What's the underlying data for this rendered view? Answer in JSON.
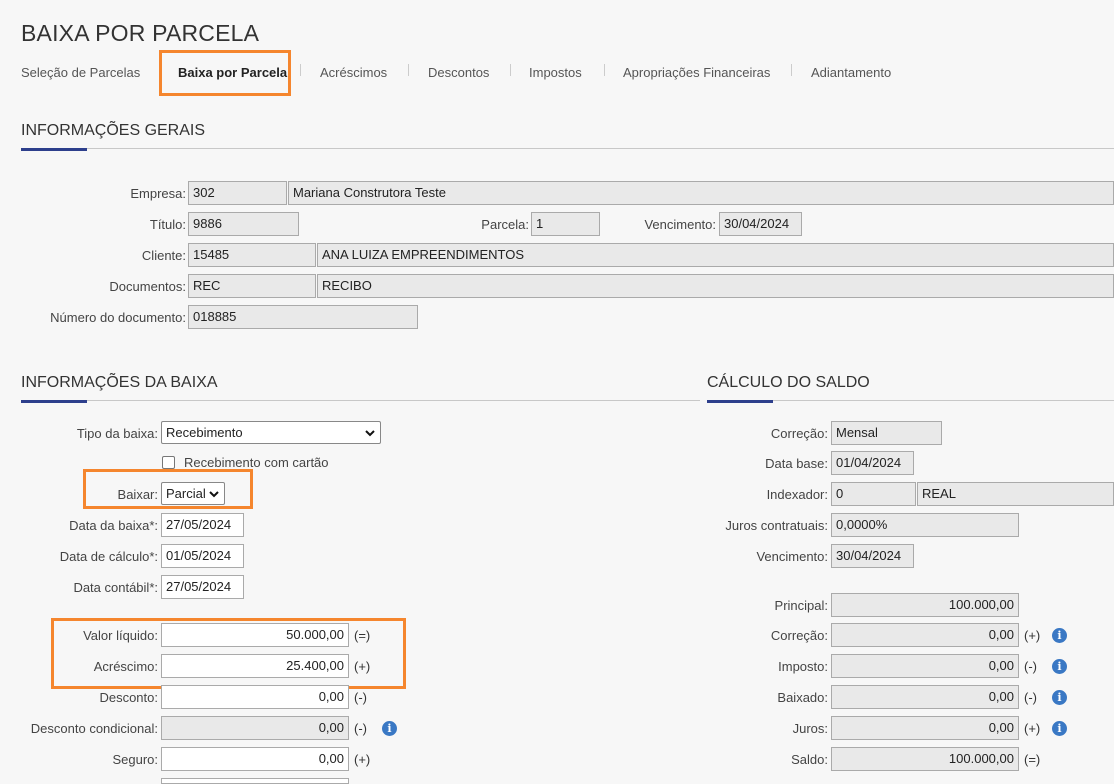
{
  "page_title": "BAIXA POR PARCELA",
  "tabs": [
    {
      "label": "Seleção de Parcelas"
    },
    {
      "label": "Baixa por Parcela"
    },
    {
      "label": "Acréscimos"
    },
    {
      "label": "Descontos"
    },
    {
      "label": "Impostos"
    },
    {
      "label": "Apropriações Financeiras"
    },
    {
      "label": "Adiantamento"
    }
  ],
  "active_tab": "Baixa por Parcela",
  "info_gerais": {
    "title": "INFORMAÇÕES GERAIS",
    "empresa_label": "Empresa:",
    "empresa_code": "302",
    "empresa_name": "Mariana Construtora Teste",
    "titulo_label": "Título:",
    "titulo": "9886",
    "parcela_label": "Parcela:",
    "parcela": "1",
    "vencimento_label": "Vencimento:",
    "vencimento": "30/04/2024",
    "cliente_label": "Cliente:",
    "cliente_code": "15485",
    "cliente_name": "ANA LUIZA EMPREENDIMENTOS",
    "documentos_label": "Documentos:",
    "documento_code": "REC",
    "documento_name": "RECIBO",
    "numero_doc_label": "Número do documento:",
    "numero_doc": "018885"
  },
  "info_baixa": {
    "title": "INFORMAÇÕES DA BAIXA",
    "tipo_label": "Tipo da baixa:",
    "tipo_value": "Recebimento",
    "cartao_label": "Recebimento com cartão",
    "cartao_checked": false,
    "baixar_label": "Baixar:",
    "baixar_value": "Parcial",
    "data_baixa_label": "Data da baixa*:",
    "data_baixa": "27/05/2024",
    "data_calculo_label": "Data de cálculo*:",
    "data_calculo": "01/05/2024",
    "data_contabil_label": "Data contábil*:",
    "data_contabil": "27/05/2024",
    "valor_liquido_label": "Valor líquido:",
    "valor_liquido": "50.000,00",
    "valor_liquido_sign": "(=)",
    "acrescimo_label": "Acréscimo:",
    "acrescimo": "25.400,00",
    "acrescimo_sign": "(+)",
    "desconto_label": "Desconto:",
    "desconto": "0,00",
    "desconto_sign": "(-)",
    "desconto_cond_label": "Desconto condicional:",
    "desconto_cond": "0,00",
    "desconto_cond_sign": "(-)",
    "seguro_label": "Seguro:",
    "seguro": "0,00",
    "seguro_sign": "(+)"
  },
  "calculo_saldo": {
    "title": "CÁLCULO DO SALDO",
    "correcao_label": "Correção:",
    "correcao": "Mensal",
    "data_base_label": "Data base:",
    "data_base": "01/04/2024",
    "indexador_label": "Indexador:",
    "indexador_code": "0",
    "indexador_name": "REAL",
    "juros_contr_label": "Juros contratuais:",
    "juros_contr": "0,0000%",
    "vencimento_label": "Vencimento:",
    "vencimento": "30/04/2024",
    "principal_label": "Principal:",
    "principal": "100.000,00",
    "correcao_val_label": "Correção:",
    "correcao_val": "0,00",
    "correcao_val_sign": "(+)",
    "imposto_label": "Imposto:",
    "imposto": "0,00",
    "imposto_sign": "(-)",
    "baixado_label": "Baixado:",
    "baixado": "0,00",
    "baixado_sign": "(-)",
    "juros_label": "Juros:",
    "juros": "0,00",
    "juros_sign": "(+)",
    "saldo_label": "Saldo:",
    "saldo": "100.000,00",
    "saldo_sign": "(=)"
  },
  "colors": {
    "highlight": "#f5862e",
    "section_accent": "#2d3f8c",
    "info_icon": "#3a78c4"
  }
}
